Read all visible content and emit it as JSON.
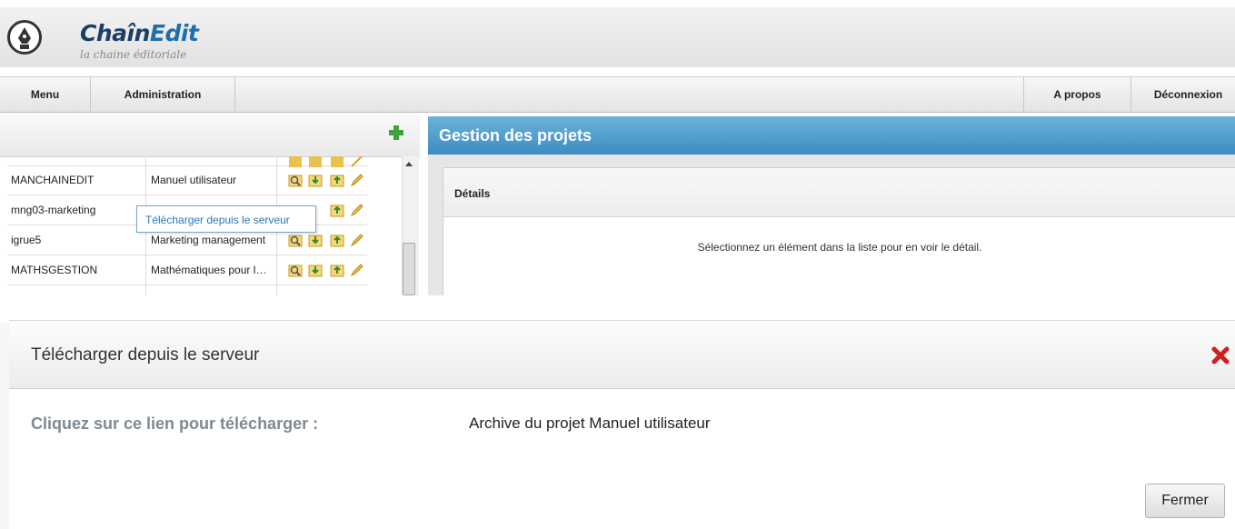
{
  "app": {
    "title_part1": "Chaîn",
    "title_part2": "Edit",
    "subtitle": "la chaine éditoriale"
  },
  "menu": {
    "left": [
      "Menu",
      "Administration"
    ],
    "right": [
      "A propos",
      "Déconnexion"
    ]
  },
  "project_list": {
    "rows": [
      {
        "code": "MANCHAINEDIT",
        "name": "Manuel utilisateur"
      },
      {
        "code": "mng03-marketing",
        "name": ""
      },
      {
        "code": "igrue5",
        "name": "Marketing management"
      },
      {
        "code": "MATHSGESTION",
        "name": "Mathématiques pour la gestion"
      }
    ],
    "tooltip": "Télécharger depuis le serveur"
  },
  "main": {
    "panel_title": "Gestion des projets",
    "details_header": "Détails",
    "details_message": "Sélectionnez un élément dans la liste pour en voir le détail."
  },
  "dialog": {
    "title": "Télécharger depuis le serveur",
    "label": "Cliquez sur ce lien pour télécharger :",
    "link": "Archive du projet Manuel utilisateur",
    "close_button": "Fermer"
  },
  "colors": {
    "accent_blue": "#3d8cc1",
    "logo_blue": "#1f6faa",
    "add_green": "#3ea33e",
    "close_red": "#cc2222"
  }
}
